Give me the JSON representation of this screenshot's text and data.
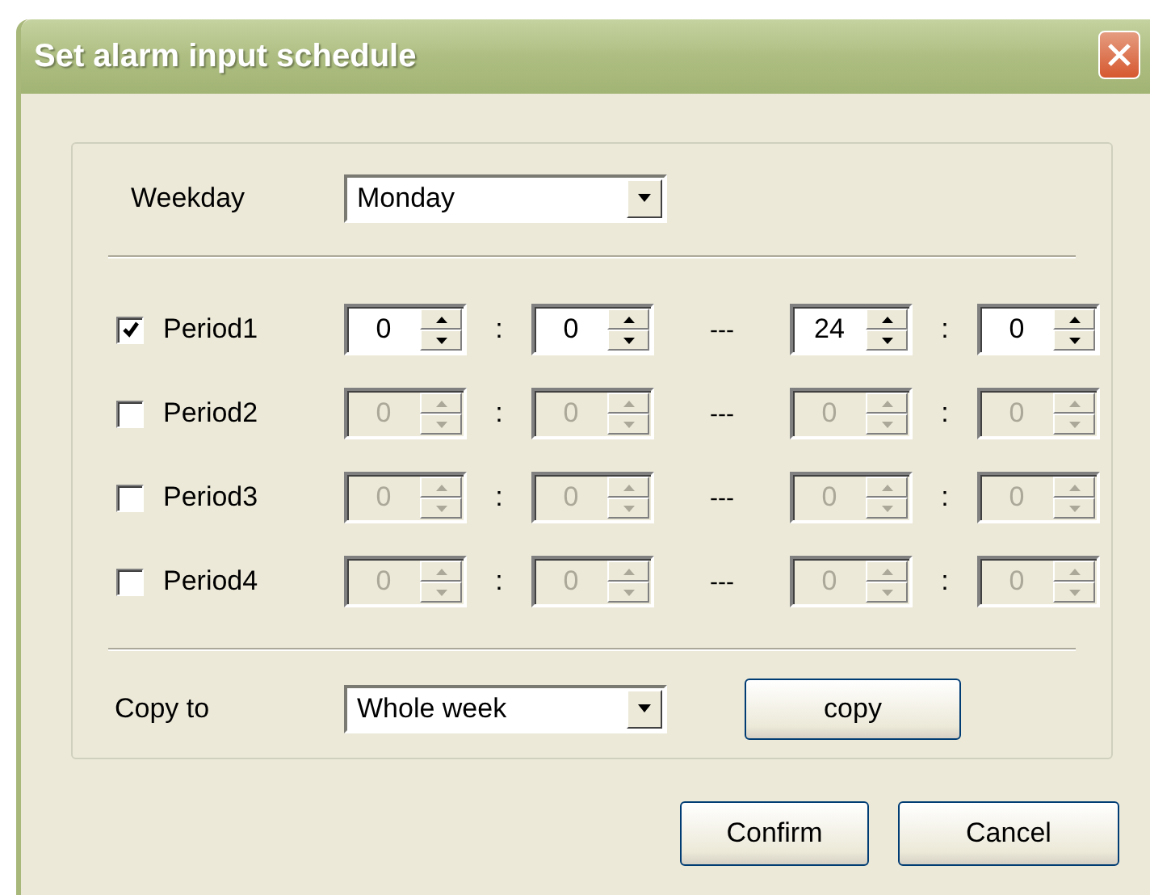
{
  "window": {
    "title": "Set alarm input schedule"
  },
  "weekday": {
    "label": "Weekday",
    "value": "Monday"
  },
  "periods": [
    {
      "label": "Period1",
      "checked": true,
      "start_hour": "0",
      "colon_1": ":",
      "start_minute": "0",
      "dash": "---",
      "end_hour": "24",
      "colon_2": ":",
      "end_minute": "0"
    },
    {
      "label": "Period2",
      "checked": false,
      "start_hour": "0",
      "colon_1": ":",
      "start_minute": "0",
      "dash": "---",
      "end_hour": "0",
      "colon_2": ":",
      "end_minute": "0"
    },
    {
      "label": "Period3",
      "checked": false,
      "start_hour": "0",
      "colon_1": ":",
      "start_minute": "0",
      "dash": "---",
      "end_hour": "0",
      "colon_2": ":",
      "end_minute": "0"
    },
    {
      "label": "Period4",
      "checked": false,
      "start_hour": "0",
      "colon_1": ":",
      "start_minute": "0",
      "dash": "---",
      "end_hour": "0",
      "colon_2": ":",
      "end_minute": "0"
    }
  ],
  "copy_to": {
    "label": "Copy to",
    "value": "Whole week",
    "button": "copy"
  },
  "buttons": [
    "Confirm",
    "Cancel"
  ]
}
